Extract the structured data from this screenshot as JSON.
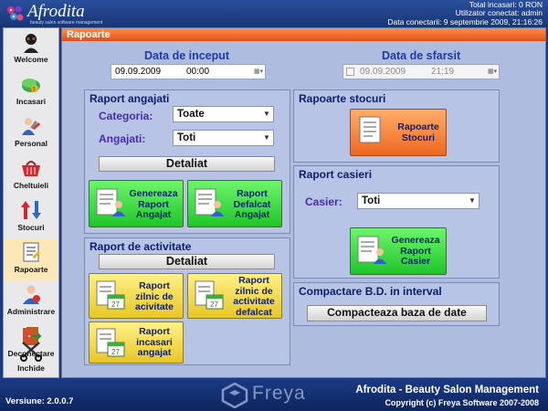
{
  "app": {
    "logo_text": "Afrodita",
    "logo_tagline": "beauty salon software management",
    "top_info": {
      "total": "Total incasari: 0 RON",
      "user": "Utilizator conectat: admin",
      "connected": "Data conectarii: 9 septembrie 2009, 21:16:26"
    }
  },
  "sidebar": {
    "items": [
      {
        "label": "Welcome",
        "icon": "welcome-icon"
      },
      {
        "label": "Incasari",
        "icon": "money-icon"
      },
      {
        "label": "Personal",
        "icon": "staff-icon"
      },
      {
        "label": "Cheltuieli",
        "icon": "basket-icon"
      },
      {
        "label": "Stocuri",
        "icon": "stock-arrows-icon"
      },
      {
        "label": "Rapoarte",
        "icon": "report-icon"
      },
      {
        "label": "Administrare",
        "icon": "admin-icon"
      },
      {
        "label": "Deconectare",
        "icon": "exit-door-icon"
      },
      {
        "label": "Inchide",
        "icon": "close-scissors-icon"
      }
    ],
    "active": "Rapoarte"
  },
  "page": {
    "title": "Rapoarte",
    "date_start": {
      "label": "Data de inceput",
      "date": "09.09.2009",
      "time": "00:00"
    },
    "date_end": {
      "label": "Data de sfarsit",
      "date": "09.09.2009",
      "time": "21:19"
    }
  },
  "raport_angajati": {
    "title": "Raport angajati",
    "categoria_label": "Categoria:",
    "categoria_value": "Toate",
    "angajati_label": "Angajati:",
    "angajati_value": "Toti",
    "detaliat": "Detaliat",
    "btn_genereaza": [
      "Genereaza",
      "Raport",
      "Angajat"
    ],
    "btn_defalcat": [
      "Raport",
      "Defalcat",
      "Angajat"
    ]
  },
  "raport_activitate": {
    "title": "Raport de activitate",
    "detaliat": "Detaliat",
    "btn_zilnic": [
      "Raport",
      "zilnic de",
      "acivitate"
    ],
    "btn_zilnic_defalcat": [
      "Raport",
      "zilnic de",
      "activitate",
      "defalcat"
    ],
    "btn_incasari": [
      "Raport",
      "incasari",
      "angajat"
    ]
  },
  "rapoarte_stocuri": {
    "title": "Rapoarte stocuri",
    "btn": [
      "Rapoarte",
      "Stocuri"
    ]
  },
  "raport_casieri": {
    "title": "Raport casieri",
    "casier_label": "Casier:",
    "casier_value": "Toti",
    "btn": [
      "Genereaza",
      "Raport",
      "Casier"
    ]
  },
  "compactare": {
    "title": "Compactare B.D. in interval",
    "btn": "Compacteaza baza de date"
  },
  "footer": {
    "version": "Versiune:  2.0.0.7",
    "freya": "Freya",
    "app_title": "Afrodita - Beauty Salon Management",
    "copyright": "Copyright (c) Freya Software 2007-2008"
  },
  "colors": {
    "header_orange": "#e0501a",
    "panel_blue": "#b7c4e6",
    "button_green": "#1fc52b",
    "button_orange": "#ef6720",
    "button_yellow": "#e8c625"
  }
}
